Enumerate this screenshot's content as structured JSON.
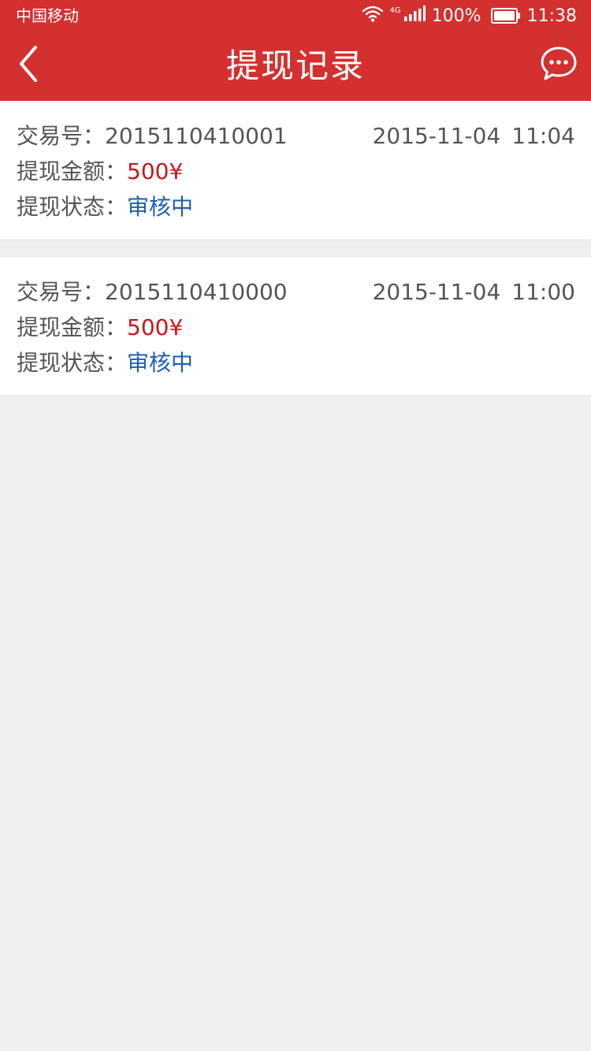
{
  "status_bar": {
    "carrier": "中国移动",
    "network": "4G",
    "battery": "100%",
    "battery_level": 1.0,
    "time": "11:38"
  },
  "header": {
    "title": "提现记录",
    "back_icon": "chevron-left-icon",
    "message_icon": "chat-bubble-icon"
  },
  "labels": {
    "trade_no": "交易号：",
    "amount": "提现金额：",
    "status": "提现状态："
  },
  "records": [
    {
      "trade_no": "2015110410001",
      "date": "2015-11-04",
      "time": "11:04",
      "amount": "500¥",
      "status": "审核中"
    },
    {
      "trade_no": "2015110410000",
      "date": "2015-11-04",
      "time": "11:00",
      "amount": "500¥",
      "status": "审核中"
    }
  ],
  "colors": {
    "header_bg": "#d43030",
    "amount": "#c8161d",
    "status": "#1e5fae",
    "page_bg": "#efefef"
  }
}
